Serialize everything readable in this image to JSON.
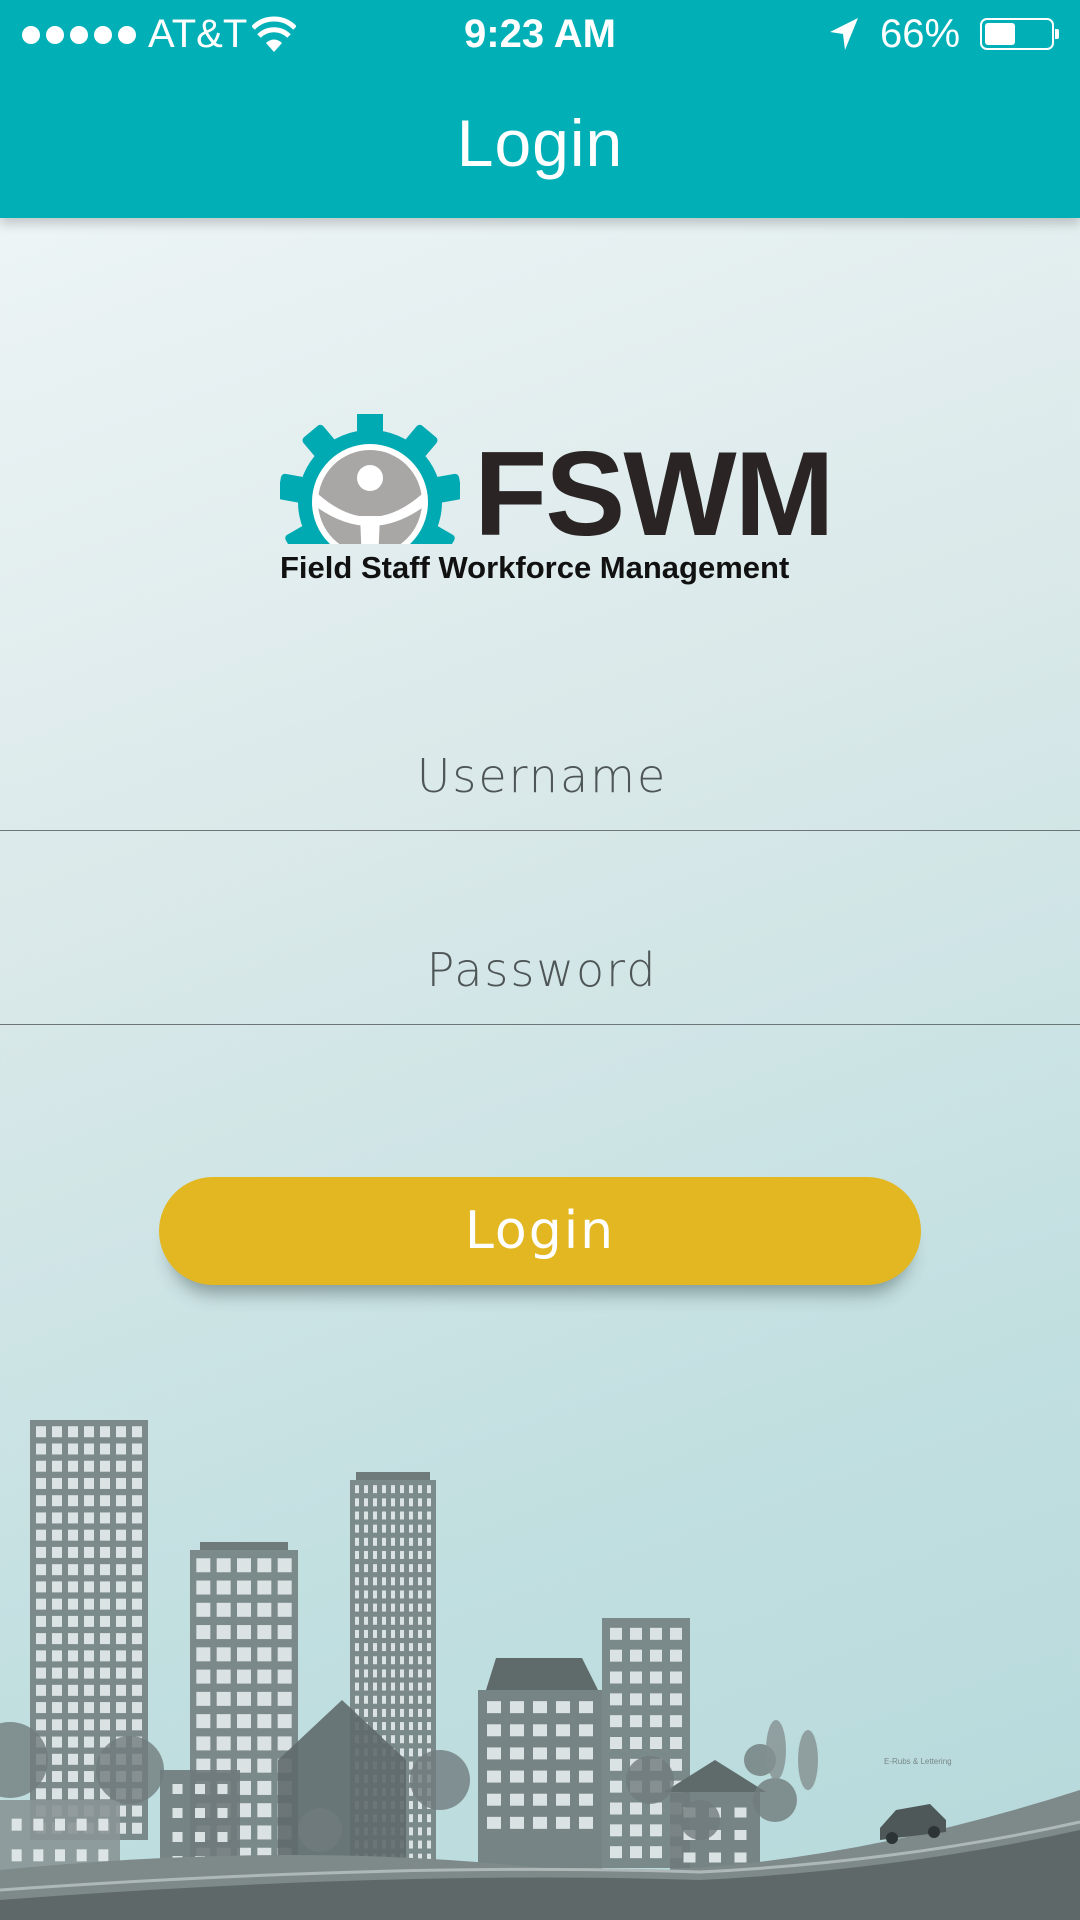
{
  "status_bar": {
    "carrier": "AT&T",
    "time": "9:23 AM",
    "battery_percent": "66%",
    "battery_level": 0.66,
    "signal_dots": 5
  },
  "nav": {
    "title": "Login"
  },
  "logo": {
    "wordmark": "FSWM",
    "subtitle": "Field Staff Workforce Management"
  },
  "form": {
    "username": {
      "placeholder": "Username",
      "value": ""
    },
    "password": {
      "placeholder": "Password",
      "value": ""
    },
    "login_button": "Login"
  },
  "illustration": {
    "credit": "E-Rubs & Lettering"
  },
  "colors": {
    "header": "#00b0b6",
    "button": "#e2b721",
    "gear": "#00aab2",
    "building": "#6f7a7b"
  }
}
